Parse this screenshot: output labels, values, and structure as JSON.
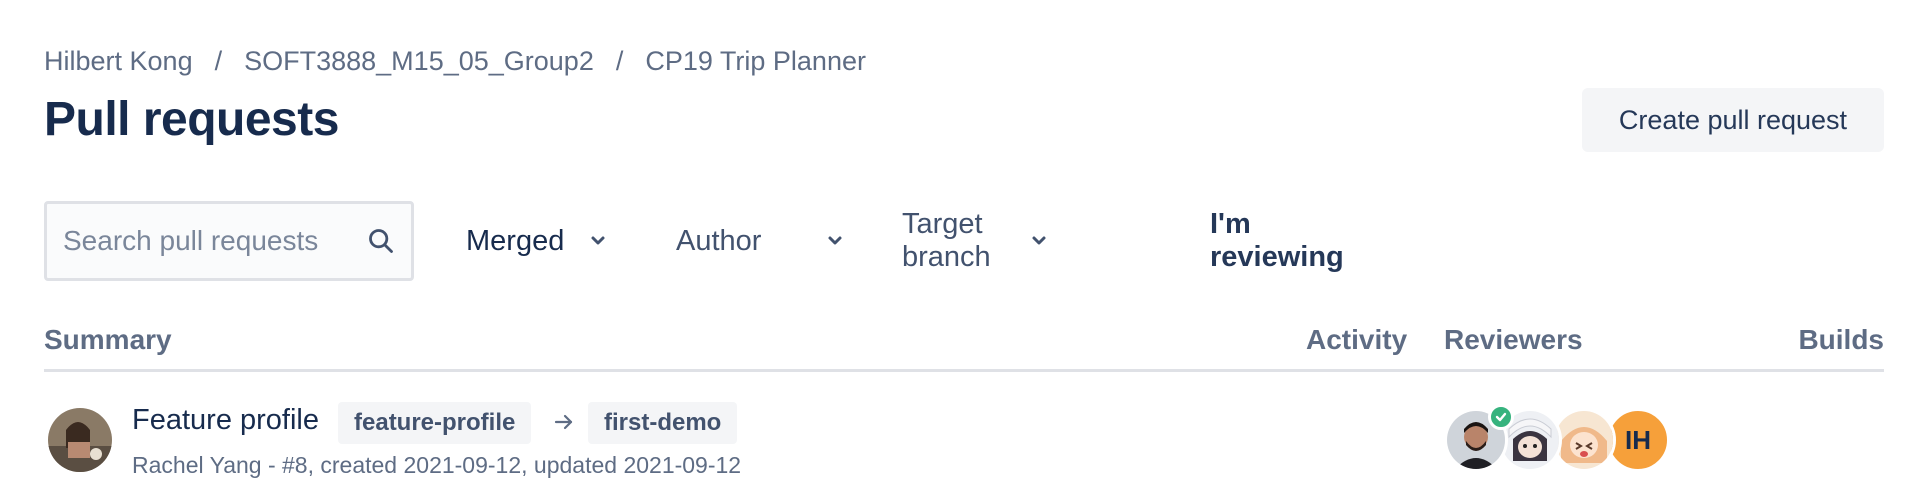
{
  "breadcrumb": {
    "items": [
      "Hilbert Kong",
      "SOFT3888_M15_05_Group2",
      "CP19 Trip Planner"
    ],
    "separator": "/"
  },
  "page_title": "Pull requests",
  "actions": {
    "create_label": "Create pull request"
  },
  "filters": {
    "search_placeholder": "Search pull requests",
    "state_label": "Merged",
    "author_label": "Author",
    "target_branch_label": "Target branch",
    "reviewing_label": "I'm reviewing"
  },
  "table": {
    "columns": {
      "summary": "Summary",
      "activity": "Activity",
      "reviewers": "Reviewers",
      "builds": "Builds"
    },
    "rows": [
      {
        "title": "Feature profile",
        "source_branch": "feature-profile",
        "target_branch": "first-demo",
        "meta": "Rachel Yang - #8, created 2021-09-12, updated 2021-09-12",
        "reviewer_initials": "IH"
      }
    ]
  },
  "colors": {
    "primary_text": "#172b4d",
    "secondary_text": "#5e6c84",
    "approved": "#36b37e",
    "initials_avatar": "#f6a03a"
  },
  "icons": [
    "search-icon",
    "chevron-down-icon",
    "arrow-right-icon",
    "check-icon"
  ]
}
